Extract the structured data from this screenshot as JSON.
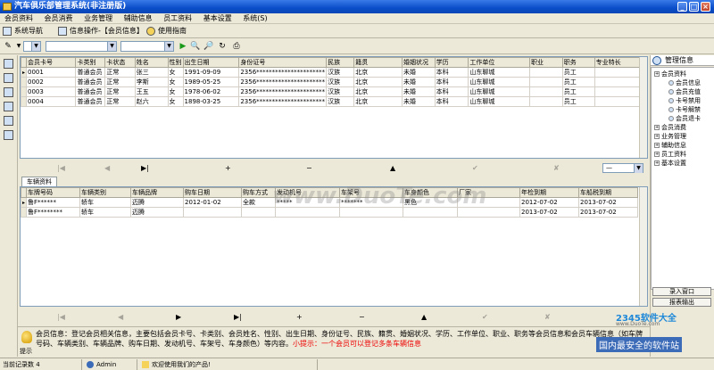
{
  "window": {
    "title": "汽车俱乐部管理系统(非注册版)"
  },
  "menu": [
    "会员资料",
    "会员消费",
    "业务管理",
    "辅助信息",
    "员工资料",
    "基本设置",
    "系统(S)"
  ],
  "nav": {
    "system_nav": "系统导航",
    "info_op": "信息操作-【会员信息】",
    "guide": "使用指南"
  },
  "members": {
    "columns": [
      "会员卡号",
      "卡类别",
      "卡状态",
      "姓名",
      "性别",
      "出生日期",
      "身份证号",
      "民族",
      "籍贯",
      "婚姻状况",
      "学历",
      "工作单位",
      "职业",
      "职务",
      "专业特长"
    ],
    "rows": [
      [
        "0001",
        "普通会员",
        "正常",
        "张三",
        "女",
        "1991-09-09",
        "2356**********************",
        "汉族",
        "北京",
        "未婚",
        "本科",
        "山东聊城",
        "",
        "员工",
        ""
      ],
      [
        "0002",
        "普通会员",
        "正常",
        "李斯",
        "女",
        "1989-05-25",
        "2356**********************",
        "汉族",
        "北京",
        "未婚",
        "本科",
        "山东聊城",
        "",
        "员工",
        ""
      ],
      [
        "0003",
        "普通会员",
        "正常",
        "王五",
        "女",
        "1978-06-02",
        "2356**********************",
        "汉族",
        "北京",
        "未婚",
        "本科",
        "山东聊城",
        "",
        "员工",
        ""
      ],
      [
        "0004",
        "普通会员",
        "正常",
        "赵六",
        "女",
        "1898-03-25",
        "2356**********************",
        "汉族",
        "北京",
        "未婚",
        "本科",
        "山东聊城",
        "",
        "员工",
        ""
      ]
    ]
  },
  "vehicle_tab": "车辆资料",
  "vehicles": {
    "columns": [
      "车牌号码",
      "车辆类别",
      "车辆品牌",
      "购车日期",
      "购车方式",
      "发动机号",
      "车架号",
      "车身颜色",
      "厂家",
      "年检到期",
      "车船税到期"
    ],
    "rows": [
      [
        "鲁F******",
        "轿车",
        "迈腾",
        "2012-01-02",
        "全款",
        "*****",
        "*******",
        "黑色",
        "",
        "2012-07-02",
        "2013-07-02"
      ],
      [
        "鲁F********",
        "轿车",
        "迈腾",
        "",
        "",
        "",
        "",
        "",
        "",
        "2013-07-02",
        "2013-07-02"
      ]
    ]
  },
  "right_panel": {
    "title": "管理信息",
    "tree": [
      {
        "label": "会员资料",
        "level": 0
      },
      {
        "label": "会员信息",
        "level": 2
      },
      {
        "label": "会员充值",
        "level": 2
      },
      {
        "label": "卡号禁用",
        "level": 2
      },
      {
        "label": "卡号解禁",
        "level": 2
      },
      {
        "label": "会员退卡",
        "level": 2
      },
      {
        "label": "会员消费",
        "level": 0
      },
      {
        "label": "业务管理",
        "level": 0
      },
      {
        "label": "辅助信息",
        "level": 0
      },
      {
        "label": "员工资料",
        "level": 0
      },
      {
        "label": "基本设置",
        "level": 0
      }
    ],
    "import_btn": "录入窗口",
    "report_btn": "报表输出"
  },
  "tip": {
    "label": "提示",
    "text": "会员信息：登记会员相关信息，主要包括会员卡号、卡类别、会员姓名、性别、出生日期、身份证号、民族、籍贯、婚姻状况、学历、工作单位、职业、职务等会员信息和会员车辆信息（如车牌号码、车辆类别、车辆品牌、购车日期、发动机号、车架号、车身颜色）等内容。",
    "hint": "小提示：一个会员可以登记多条车辆信息"
  },
  "status": {
    "records": "当前记录数 4",
    "user": "Admin",
    "welcome": "欢迎使用我们的产品!"
  },
  "watermark": {
    "main": "www.DuoTe.com",
    "logo": "2345软件大全",
    "logo_sub": "www.DuoTe.com",
    "banner": "国内最安全的软件站"
  }
}
